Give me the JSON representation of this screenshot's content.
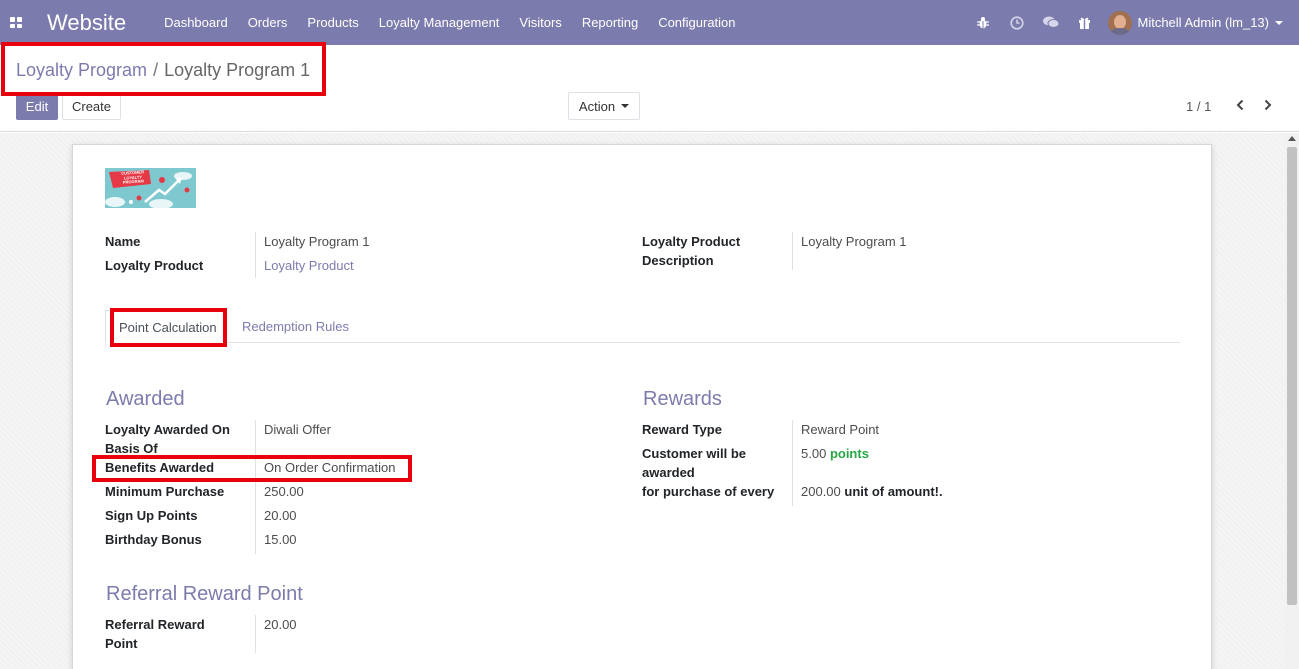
{
  "navbar": {
    "brand": "Website",
    "menu": [
      "Dashboard",
      "Orders",
      "Products",
      "Loyalty Management",
      "Visitors",
      "Reporting",
      "Configuration"
    ],
    "user": "Mitchell Admin (lm_13)",
    "icons": [
      "bug-icon",
      "clock-icon",
      "chat-icon",
      "gift-icon"
    ]
  },
  "breadcrumb": {
    "parent": "Loyalty Program",
    "separator": "/",
    "current": "Loyalty Program 1"
  },
  "toolbar": {
    "edit_label": "Edit",
    "create_label": "Create",
    "action_label": "Action"
  },
  "pager": {
    "value": "1 / 1"
  },
  "program_image": {
    "lines": [
      "CUSTOMER",
      "LOYALTY",
      "PROGRAM"
    ]
  },
  "form": {
    "name_label": "Name",
    "name_value": "Loyalty Program 1",
    "loyalty_product_label": "Loyalty Product",
    "loyalty_product_value": "Loyalty Product",
    "description_label_1": "Loyalty Product",
    "description_label_2": "Description",
    "description_value": "Loyalty Program 1"
  },
  "tabs": [
    "Point Calculation",
    "Redemption Rules"
  ],
  "awarded": {
    "title": "Awarded",
    "basis_label_1": "Loyalty Awarded On",
    "basis_label_2": "Basis Of",
    "basis_value": "Diwali Offer",
    "benefits_label": "Benefits Awarded",
    "benefits_value": "On Order Confirmation",
    "min_purchase_label": "Minimum Purchase",
    "min_purchase_value": "250.00",
    "signup_label": "Sign Up Points",
    "signup_value": "20.00",
    "birthday_label": "Birthday Bonus",
    "birthday_value": "15.00"
  },
  "rewards": {
    "title": "Rewards",
    "type_label": "Reward Type",
    "type_value": "Reward Point",
    "customer_label_1": "Customer will be",
    "customer_label_2": "awarded",
    "customer_value": "5.00",
    "customer_unit": "points",
    "purchase_label": "for purchase of every",
    "purchase_value": "200.00",
    "purchase_unit": "unit of amount!."
  },
  "referral": {
    "title": "Referral Reward Point",
    "label_1": "Referral Reward",
    "label_2": "Point",
    "value": "20.00"
  }
}
